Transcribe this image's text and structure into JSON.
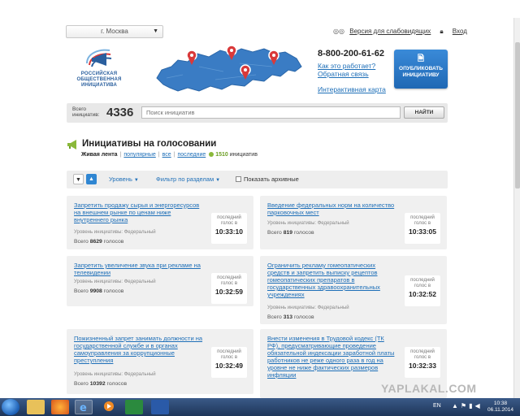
{
  "topbar": {
    "city": "г. Москва",
    "accessible_version": "Версия для слабовидящих",
    "login": "Вход"
  },
  "header": {
    "logo_lines": [
      "РОССИЙСКАЯ",
      "ОБЩЕСТВЕННАЯ",
      "ИНИЦИАТИВА"
    ],
    "phone": "8-800-200-61-62",
    "links": {
      "how_it_works": "Как это работает?",
      "feedback": "Обратная связь",
      "interactive_map": "Интерактивная карта"
    },
    "publish_button": "ОПУБЛИКОВАТЬ ИНИЦИАТИВУ"
  },
  "search": {
    "count_label_line1": "Всего",
    "count_label_line2": "инициатив:",
    "count": "4336",
    "placeholder": "Поиск инициатив",
    "button": "НАЙТИ"
  },
  "section": {
    "title": "Инициативы на голосовании",
    "filters": {
      "live": "Живая лента",
      "popular": "популярные",
      "all": "все",
      "latest": "последние",
      "count": "1510",
      "count_suffix": "инициатив"
    }
  },
  "toolbar": {
    "level": "Уровень",
    "section_filter": "Фильтр по разделам",
    "show_archived": "Показать архивные"
  },
  "cards": [
    {
      "title": "Запретить продажу сырья и энергоресурсов на внешнем рынке по ценам ниже внутреннего рынка",
      "level": "Уровень инициативы: Федеральный",
      "total_prefix": "Всего",
      "votes": "8629",
      "votes_suffix": "голосов",
      "time_label": "последний голос в",
      "time": "10:33:10"
    },
    {
      "title": "Введение федеральных норм на количество парковочных мест",
      "level": "Уровень инициативы: Федеральный",
      "total_prefix": "Всего",
      "votes": "819",
      "votes_suffix": "голосов",
      "time_label": "последний голос в",
      "time": "10:33:05"
    },
    {
      "title": "Запретить увеличение звука при рекламе на телевидении",
      "level": "Уровень инициативы: Федеральный",
      "total_prefix": "Всего",
      "votes": "9908",
      "votes_suffix": "голосов",
      "time_label": "последний голос в",
      "time": "10:32:59"
    },
    {
      "title": "Ограничить рекламу гомеопатических средств и запретить выписку рецептов гомеопатических препаратов в государственных здравоохранительных учреждениях",
      "level": "Уровень инициативы: Федеральный",
      "total_prefix": "Всего",
      "votes": "313",
      "votes_suffix": "голосов",
      "time_label": "последний голос в",
      "time": "10:32:52"
    },
    {
      "title": "Пожизненный запрет занимать должности на государственной службе и в органах самоуправления за коррупционные преступления",
      "level": "Уровень инициативы: Федеральный",
      "total_prefix": "Всего",
      "votes": "10392",
      "votes_suffix": "голосов",
      "time_label": "последний голос в",
      "time": "10:32:49"
    },
    {
      "title": "Внести изменения в Трудовой кодекс (ТК РФ), предусматривающие проведение обязательной индексации заработной платы работников не реже одного раза в год на уровне не ниже фактических размеров инфляции",
      "level": "",
      "total_prefix": "",
      "votes": "",
      "votes_suffix": "",
      "time_label": "последний голос в",
      "time": "10:32:33"
    }
  ],
  "watermark": "YAPLAKAL.COM",
  "taskbar": {
    "lang": "EN",
    "time": "10:38",
    "date": "06.11.2014"
  },
  "colors": {
    "link": "#1e6fb8",
    "accent_button": "#1f68b4",
    "map_blue": "#3a7cc4",
    "pin_red": "#d9393a",
    "green_dot": "#8ab93a"
  }
}
